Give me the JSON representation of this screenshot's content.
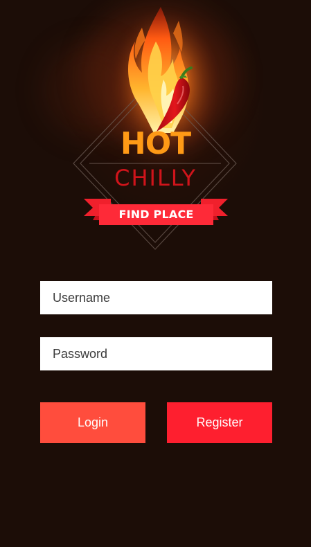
{
  "logo": {
    "line1": "HOT",
    "line2": "CHILLY",
    "ribbon": "FIND PLACE"
  },
  "form": {
    "username_placeholder": "Username",
    "username_value": "",
    "password_placeholder": "Password",
    "password_value": ""
  },
  "buttons": {
    "login_label": "Login",
    "register_label": "Register"
  },
  "colors": {
    "background": "#1c0d07",
    "hot_text": "#ff9a16",
    "chilly_text": "#d0141b",
    "ribbon": "#fe1f2f",
    "login_button": "#ff4d3d",
    "register_button": "#fe1f2f"
  }
}
